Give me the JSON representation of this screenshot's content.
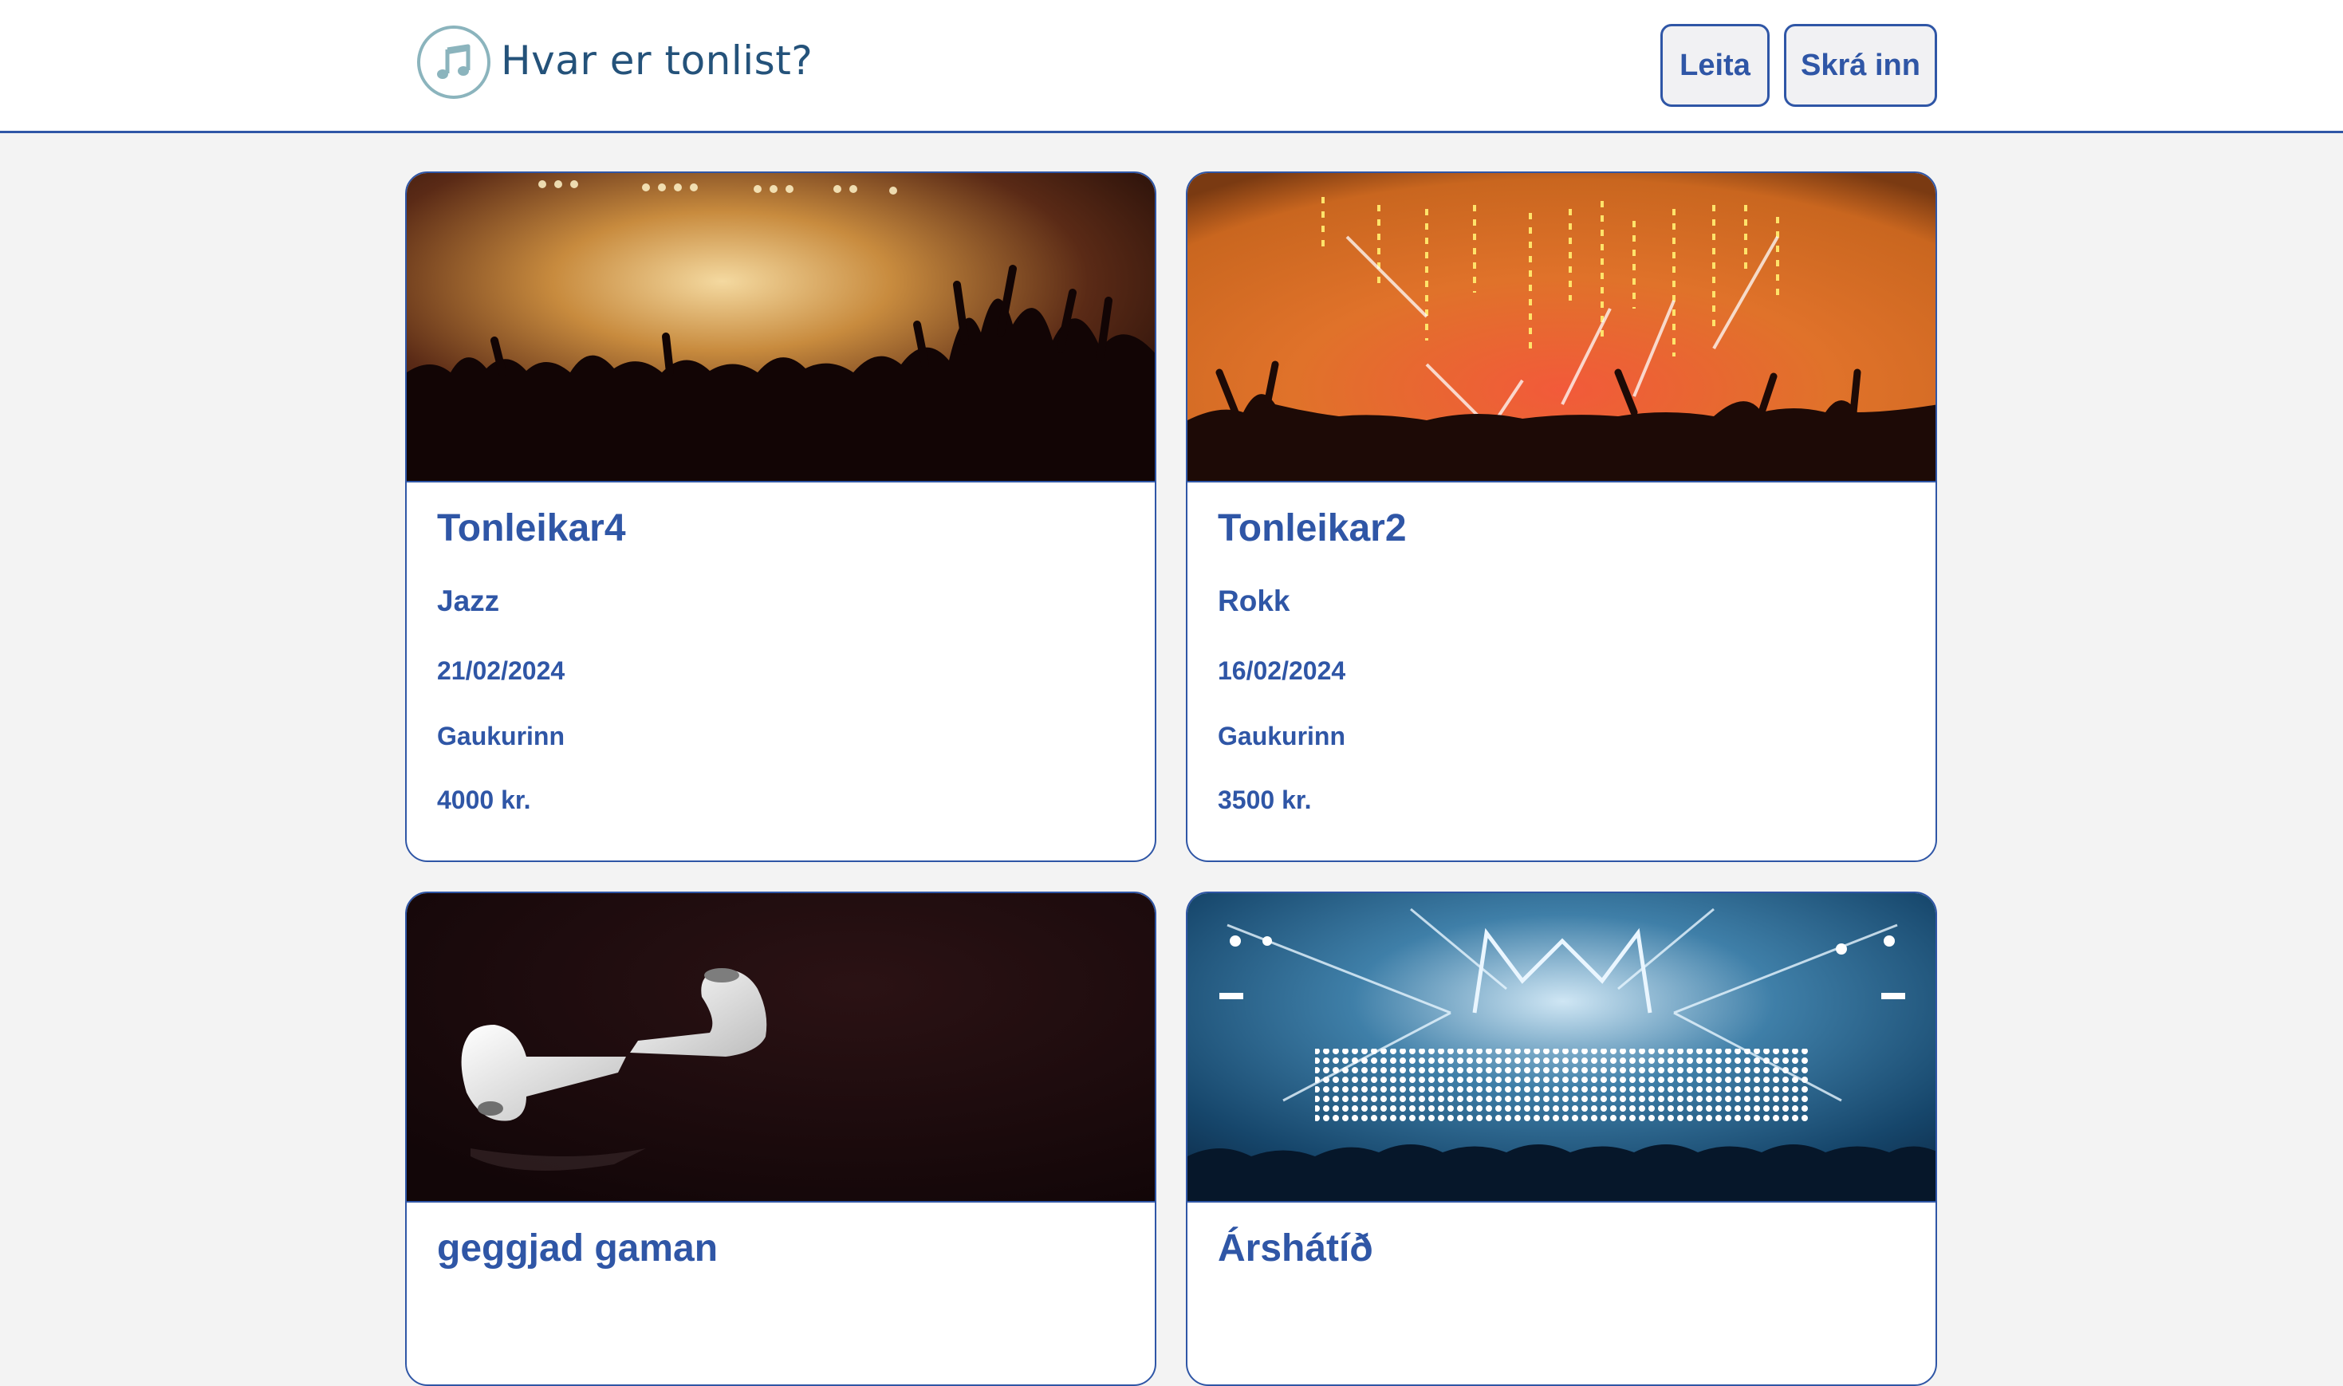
{
  "header": {
    "site_title": "Hvar er tonlist?",
    "logo_icon": "music-note-icon",
    "search_label": "Leita",
    "login_label": "Skrá inn"
  },
  "colors": {
    "accent": "#2f56a6",
    "title": "#24527a",
    "logo_ring": "#8bb4bd",
    "background": "#f3f3f3"
  },
  "events": [
    {
      "title": "Tonleikar4",
      "genre": "Jazz",
      "date": "21/02/2024",
      "venue": "Gaukurinn",
      "price": "4000 kr."
    },
    {
      "title": "Tonleikar2",
      "genre": "Rokk",
      "date": "16/02/2024",
      "venue": "Gaukurinn",
      "price": "3500 kr."
    },
    {
      "title": "geggjad gaman"
    },
    {
      "title": "Árshátíð"
    }
  ]
}
